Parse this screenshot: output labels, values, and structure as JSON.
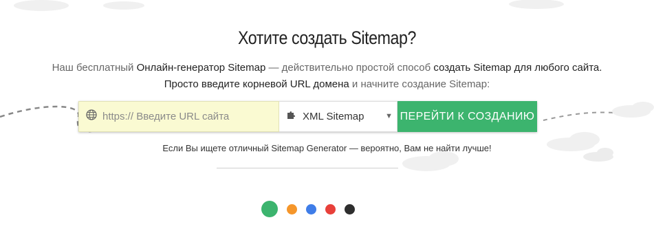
{
  "hero": {
    "title": "Хотите создать Sitemap?",
    "line1": {
      "part1": "Наш бесплатный ",
      "part2": "Онлайн-генератор Sitemap",
      "part3": " — действительно простой способ ",
      "part4": "создать Sitemap для любого сайта."
    },
    "line2": {
      "part1": "Просто введите корневой URL домена",
      "part2": " и начните создание Sitemap:"
    }
  },
  "form": {
    "url_placeholder": "https:// Введите URL сайта",
    "url_icon": "globe-icon",
    "type_icon": "puzzle-icon",
    "type_selected": "XML Sitemap",
    "submit_label": "ПЕРЕЙТИ К СОЗДАНИЮ",
    "submit_color": "#3cb46e",
    "input_bg": "#fafad2"
  },
  "tagline": "Если Вы ищете отличный Sitemap Generator — вероятно, Вам не найти лучше!",
  "theme_dots": [
    {
      "color": "#3cb46e",
      "active": true
    },
    {
      "color": "#f5962a",
      "active": false
    },
    {
      "color": "#3f7de8",
      "active": false
    },
    {
      "color": "#e8403a",
      "active": false
    },
    {
      "color": "#2e2e2e",
      "active": false
    }
  ]
}
